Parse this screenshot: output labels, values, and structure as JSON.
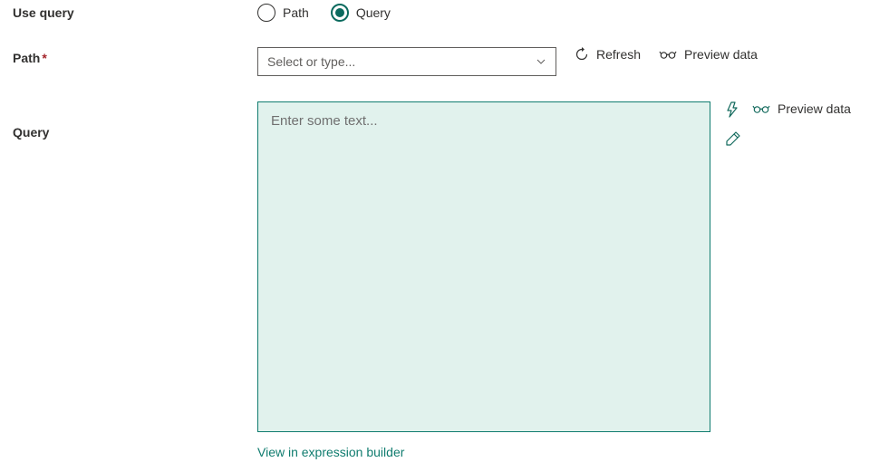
{
  "labels": {
    "use_query": "Use query",
    "path": "Path",
    "query": "Query"
  },
  "radio": {
    "path": "Path",
    "query": "Query",
    "selected": "query"
  },
  "path_select": {
    "placeholder": "Select or type..."
  },
  "actions": {
    "refresh": "Refresh",
    "preview_data": "Preview data"
  },
  "query_area": {
    "placeholder": "Enter some text...",
    "value": ""
  },
  "links": {
    "expression_builder": "View in expression builder"
  }
}
